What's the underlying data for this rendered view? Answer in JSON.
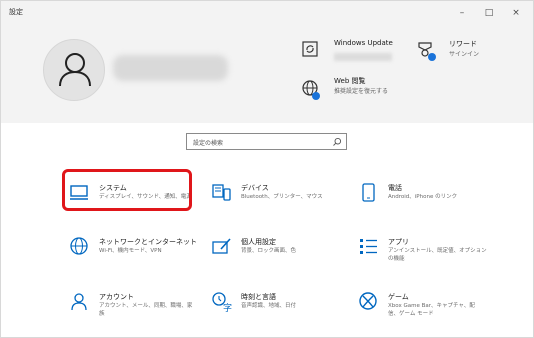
{
  "window": {
    "title": "設定",
    "controls": {
      "minimize": "–",
      "maximize": "□",
      "close": "×"
    }
  },
  "header": {
    "windows_update": {
      "title": "Windows Update",
      "icon": "windows-update-icon"
    },
    "rewards": {
      "title": "リワード",
      "subtitle": "サインイン",
      "icon": "rewards-icon"
    },
    "web_browse": {
      "title": "Web 閲覧",
      "subtitle": "推奨設定を復元する",
      "icon": "web-browse-icon"
    }
  },
  "search": {
    "placeholder": "設定の検索"
  },
  "tiles": [
    {
      "title": "システム",
      "subtitle": "ディスプレイ、サウンド、通知、電源",
      "icon": "monitor-icon"
    },
    {
      "title": "デバイス",
      "subtitle": "Bluetooth、プリンター、マウス",
      "icon": "devices-icon"
    },
    {
      "title": "電話",
      "subtitle": "Android、iPhone のリンク",
      "icon": "phone-icon"
    },
    {
      "title": "ネットワークとインターネット",
      "subtitle": "Wi-Fi、機内モード、VPN",
      "icon": "globe-icon"
    },
    {
      "title": "個人用設定",
      "subtitle": "背景、ロック画面、色",
      "icon": "personalization-icon"
    },
    {
      "title": "アプリ",
      "subtitle": "アンインストール、既定値、オプション",
      "subtitle2": "の機能",
      "icon": "apps-icon"
    },
    {
      "title": "アカウント",
      "subtitle": "アカウント、メール、同期、職場、家",
      "subtitle2": "族",
      "icon": "account-icon"
    },
    {
      "title": "時刻と言語",
      "subtitle": "音声認識、地域、日付",
      "icon": "time-language-icon"
    },
    {
      "title": "ゲーム",
      "subtitle": "Xbox Game Bar、キャプチャ、配",
      "subtitle2": "信、ゲーム モード",
      "icon": "xbox-icon"
    }
  ],
  "colors": {
    "accent": "#0067c0",
    "highlight": "#e0161a",
    "header_bg": "#f3f3f3"
  }
}
